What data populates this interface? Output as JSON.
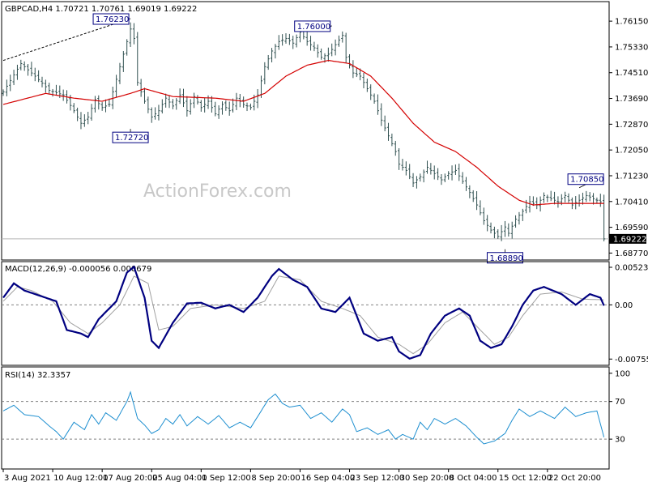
{
  "chart_data": [
    {
      "type": "candlestick",
      "header": "GBPCAD,H4  1.70721 1.70761 1.69019 1.69222",
      "watermark": "ActionForex.com",
      "ylim": [
        1.686,
        1.7672
      ],
      "y_ticks": [
        "1.76150",
        "1.75330",
        "1.74510",
        "1.73690",
        "1.72870",
        "1.72050",
        "1.71230",
        "1.70410",
        "1.69590",
        "1.68770"
      ],
      "last_price_label": "1.69222",
      "last_price": 1.69222,
      "close_path": [
        [
          0,
          1.739
        ],
        [
          5,
          1.748
        ],
        [
          9,
          1.744
        ],
        [
          13,
          1.7395
        ],
        [
          17,
          1.738
        ],
        [
          20,
          1.733
        ],
        [
          22,
          1.729
        ],
        [
          24,
          1.731
        ],
        [
          26,
          1.7365
        ],
        [
          28,
          1.734
        ],
        [
          30,
          1.735
        ],
        [
          32,
          1.743
        ],
        [
          34,
          1.751
        ],
        [
          36,
          1.759
        ],
        [
          37,
          1.756
        ],
        [
          38,
          1.742
        ],
        [
          40,
          1.736
        ],
        [
          42,
          1.731
        ],
        [
          44,
          1.733
        ],
        [
          46,
          1.737
        ],
        [
          48,
          1.7345
        ],
        [
          50,
          1.738
        ],
        [
          52,
          1.733
        ],
        [
          54,
          1.7375
        ],
        [
          56,
          1.734
        ],
        [
          58,
          1.736
        ],
        [
          60,
          1.732
        ],
        [
          62,
          1.735
        ],
        [
          64,
          1.733
        ],
        [
          66,
          1.737
        ],
        [
          68,
          1.735
        ],
        [
          70,
          1.734
        ],
        [
          72,
          1.738
        ],
        [
          74,
          1.747
        ],
        [
          76,
          1.752
        ],
        [
          78,
          1.755
        ],
        [
          80,
          1.756
        ],
        [
          82,
          1.7545
        ],
        [
          84,
          1.758
        ],
        [
          86,
          1.755
        ],
        [
          88,
          1.753
        ],
        [
          90,
          1.75
        ],
        [
          92,
          1.751
        ],
        [
          94,
          1.754
        ],
        [
          96,
          1.757
        ],
        [
          97,
          1.75
        ],
        [
          99,
          1.745
        ],
        [
          101,
          1.744
        ],
        [
          103,
          1.74
        ],
        [
          105,
          1.736
        ],
        [
          107,
          1.73
        ],
        [
          109,
          1.725
        ],
        [
          111,
          1.72
        ],
        [
          112,
          1.716
        ],
        [
          114,
          1.714
        ],
        [
          116,
          1.71
        ],
        [
          118,
          1.712
        ],
        [
          120,
          1.715
        ],
        [
          122,
          1.713
        ],
        [
          124,
          1.711
        ],
        [
          126,
          1.713
        ],
        [
          128,
          1.714
        ],
        [
          130,
          1.7105
        ],
        [
          132,
          1.707
        ],
        [
          134,
          1.703
        ],
        [
          136,
          1.698
        ],
        [
          138,
          1.695
        ],
        [
          140,
          1.693
        ],
        [
          142,
          1.696
        ],
        [
          143,
          1.694
        ],
        [
          145,
          1.6985
        ],
        [
          147,
          1.701
        ],
        [
          149,
          1.704
        ],
        [
          151,
          1.703
        ],
        [
          153,
          1.706
        ],
        [
          155,
          1.705
        ],
        [
          157,
          1.704
        ],
        [
          159,
          1.706
        ],
        [
          161,
          1.703
        ],
        [
          163,
          1.7045
        ],
        [
          165,
          1.706
        ],
        [
          167,
          1.705
        ],
        [
          169,
          1.704
        ],
        [
          170,
          1.6922
        ]
      ],
      "wick": 0.0022,
      "series": [
        {
          "name": "",
          "color": "#d40000",
          "values": [
            [
              0,
              1.735
            ],
            [
              12,
              1.7385
            ],
            [
              20,
              1.737
            ],
            [
              28,
              1.736
            ],
            [
              36,
              1.7385
            ],
            [
              40,
              1.74
            ],
            [
              48,
              1.7375
            ],
            [
              60,
              1.737
            ],
            [
              68,
              1.736
            ],
            [
              74,
              1.7385
            ],
            [
              80,
              1.744
            ],
            [
              86,
              1.7475
            ],
            [
              92,
              1.749
            ],
            [
              98,
              1.748
            ],
            [
              104,
              1.744
            ],
            [
              110,
              1.737
            ],
            [
              116,
              1.729
            ],
            [
              122,
              1.723
            ],
            [
              128,
              1.72
            ],
            [
              134,
              1.715
            ],
            [
              140,
              1.709
            ],
            [
              146,
              1.7045
            ],
            [
              150,
              1.703
            ],
            [
              156,
              1.7035
            ],
            [
              162,
              1.7035
            ],
            [
              170,
              1.7035
            ]
          ]
        }
      ],
      "annotations": [
        {
          "text": "1.76230",
          "x": 36,
          "y": 1.7623,
          "pos": "left"
        },
        {
          "text": "1.72720",
          "x": 36,
          "y": 1.7272,
          "pos": "below"
        },
        {
          "text": "1.76000",
          "x": 93,
          "y": 1.76,
          "pos": "left"
        },
        {
          "text": "1.68890",
          "x": 142,
          "y": 1.6889,
          "pos": "below"
        },
        {
          "text": "1.70850",
          "x": 163,
          "y": 1.7085,
          "pos": "above"
        }
      ],
      "trendline": [
        [
          0,
          1.749
        ],
        [
          36,
          1.7623
        ]
      ]
    },
    {
      "type": "line",
      "title": "MACD(12,26,9) -0.000056 0.000679",
      "ylim": [
        -0.0082,
        0.0058
      ],
      "y_ticks": [
        "0.005234",
        "0.00",
        "-0.007555"
      ],
      "series": [
        {
          "name": "",
          "color": "#000080",
          "values": [
            [
              0,
              0.001
            ],
            [
              3,
              0.003
            ],
            [
              6,
              0.002
            ],
            [
              12,
              0.001
            ],
            [
              15,
              0.0005
            ],
            [
              18,
              -0.0035
            ],
            [
              22,
              -0.004
            ],
            [
              24,
              -0.0045
            ],
            [
              27,
              -0.002
            ],
            [
              32,
              0.0005
            ],
            [
              35,
              0.0045
            ],
            [
              37,
              0.0053
            ],
            [
              40,
              0.001
            ],
            [
              42,
              -0.005
            ],
            [
              44,
              -0.006
            ],
            [
              48,
              -0.0025
            ],
            [
              52,
              0.0002
            ],
            [
              56,
              0.0003
            ],
            [
              60,
              -0.0005
            ],
            [
              64,
              0.0
            ],
            [
              68,
              -0.001
            ],
            [
              72,
              0.001
            ],
            [
              76,
              0.004
            ],
            [
              78,
              0.005
            ],
            [
              82,
              0.0035
            ],
            [
              86,
              0.0025
            ],
            [
              90,
              -0.0005
            ],
            [
              94,
              -0.001
            ],
            [
              98,
              0.001
            ],
            [
              100,
              -0.0015
            ],
            [
              102,
              -0.004
            ],
            [
              106,
              -0.005
            ],
            [
              110,
              -0.0045
            ],
            [
              112,
              -0.0065
            ],
            [
              115,
              -0.0075
            ],
            [
              118,
              -0.007
            ],
            [
              121,
              -0.004
            ],
            [
              125,
              -0.0015
            ],
            [
              129,
              -0.0005
            ],
            [
              132,
              -0.0015
            ],
            [
              135,
              -0.005
            ],
            [
              138,
              -0.006
            ],
            [
              141,
              -0.0055
            ],
            [
              144,
              -0.003
            ],
            [
              147,
              0.0
            ],
            [
              150,
              0.002
            ],
            [
              153,
              0.0025
            ],
            [
              158,
              0.0015
            ],
            [
              162,
              0.0
            ],
            [
              166,
              0.0015
            ],
            [
              169,
              0.001
            ],
            [
              170,
              -0.0001
            ]
          ]
        },
        {
          "name": "",
          "color": "#a0a0a0",
          "values": [
            [
              0,
              0.0005
            ],
            [
              4,
              0.0025
            ],
            [
              8,
              0.002
            ],
            [
              14,
              0.0005
            ],
            [
              19,
              -0.0025
            ],
            [
              24,
              -0.004
            ],
            [
              28,
              -0.0025
            ],
            [
              33,
              0.0
            ],
            [
              37,
              0.004
            ],
            [
              41,
              0.003
            ],
            [
              44,
              -0.0035
            ],
            [
              48,
              -0.003
            ],
            [
              53,
              -0.0005
            ],
            [
              60,
              0.0
            ],
            [
              68,
              -0.0005
            ],
            [
              74,
              0.0005
            ],
            [
              78,
              0.004
            ],
            [
              84,
              0.0035
            ],
            [
              90,
              0.0005
            ],
            [
              96,
              -0.0005
            ],
            [
              101,
              -0.0015
            ],
            [
              106,
              -0.0045
            ],
            [
              112,
              -0.0055
            ],
            [
              116,
              -0.0068
            ],
            [
              120,
              -0.0055
            ],
            [
              125,
              -0.0025
            ],
            [
              130,
              -0.001
            ],
            [
              135,
              -0.0035
            ],
            [
              139,
              -0.0055
            ],
            [
              143,
              -0.0045
            ],
            [
              147,
              -0.0015
            ],
            [
              152,
              0.0015
            ],
            [
              158,
              0.0018
            ],
            [
              164,
              0.0008
            ],
            [
              170,
              0.0007
            ]
          ]
        }
      ],
      "zero_line": 0
    },
    {
      "type": "line",
      "title": "RSI(14) 32.3357",
      "ylim": [
        0,
        105
      ],
      "y_ticks": [
        "100",
        "70",
        "30"
      ],
      "levels": [
        70,
        30
      ],
      "series": [
        {
          "name": "",
          "color": "#1e8fd0",
          "values": [
            [
              0,
              60
            ],
            [
              3,
              66
            ],
            [
              6,
              56
            ],
            [
              10,
              54
            ],
            [
              13,
              44
            ],
            [
              15,
              38
            ],
            [
              17,
              30
            ],
            [
              20,
              48
            ],
            [
              23,
              40
            ],
            [
              25,
              56
            ],
            [
              27,
              46
            ],
            [
              29,
              58
            ],
            [
              32,
              50
            ],
            [
              35,
              70
            ],
            [
              36,
              80
            ],
            [
              38,
              52
            ],
            [
              40,
              45
            ],
            [
              42,
              36
            ],
            [
              44,
              40
            ],
            [
              46,
              52
            ],
            [
              48,
              46
            ],
            [
              50,
              56
            ],
            [
              52,
              44
            ],
            [
              55,
              54
            ],
            [
              58,
              46
            ],
            [
              61,
              55
            ],
            [
              64,
              42
            ],
            [
              67,
              48
            ],
            [
              70,
              42
            ],
            [
              73,
              60
            ],
            [
              75,
              72
            ],
            [
              77,
              78
            ],
            [
              79,
              68
            ],
            [
              81,
              64
            ],
            [
              84,
              66
            ],
            [
              87,
              52
            ],
            [
              90,
              58
            ],
            [
              93,
              48
            ],
            [
              96,
              62
            ],
            [
              98,
              56
            ],
            [
              100,
              38
            ],
            [
              103,
              42
            ],
            [
              106,
              35
            ],
            [
              109,
              40
            ],
            [
              111,
              30
            ],
            [
              113,
              35
            ],
            [
              116,
              30
            ],
            [
              118,
              48
            ],
            [
              120,
              40
            ],
            [
              122,
              52
            ],
            [
              125,
              46
            ],
            [
              128,
              52
            ],
            [
              131,
              44
            ],
            [
              134,
              32
            ],
            [
              136,
              25
            ],
            [
              139,
              28
            ],
            [
              142,
              36
            ],
            [
              144,
              50
            ],
            [
              146,
              62
            ],
            [
              149,
              54
            ],
            [
              152,
              60
            ],
            [
              156,
              52
            ],
            [
              159,
              64
            ],
            [
              162,
              54
            ],
            [
              165,
              58
            ],
            [
              168,
              60
            ],
            [
              170,
              32
            ]
          ]
        }
      ]
    }
  ],
  "x_axis": {
    "labels": [
      "3 Aug 2021",
      "10 Aug 12:00",
      "17 Aug 20:00",
      "25 Aug 04:00",
      "1 Sep 12:00",
      "8 Sep 20:00",
      "16 Sep 04:00",
      "23 Sep 12:00",
      "30 Sep 20:00",
      "8 Oct 04:00",
      "15 Oct 12:00",
      "22 Oct 20:00"
    ],
    "positions": [
      0,
      14,
      28,
      42,
      56,
      70,
      84,
      98,
      112,
      126,
      140,
      154
    ],
    "range": [
      0,
      171
    ]
  }
}
